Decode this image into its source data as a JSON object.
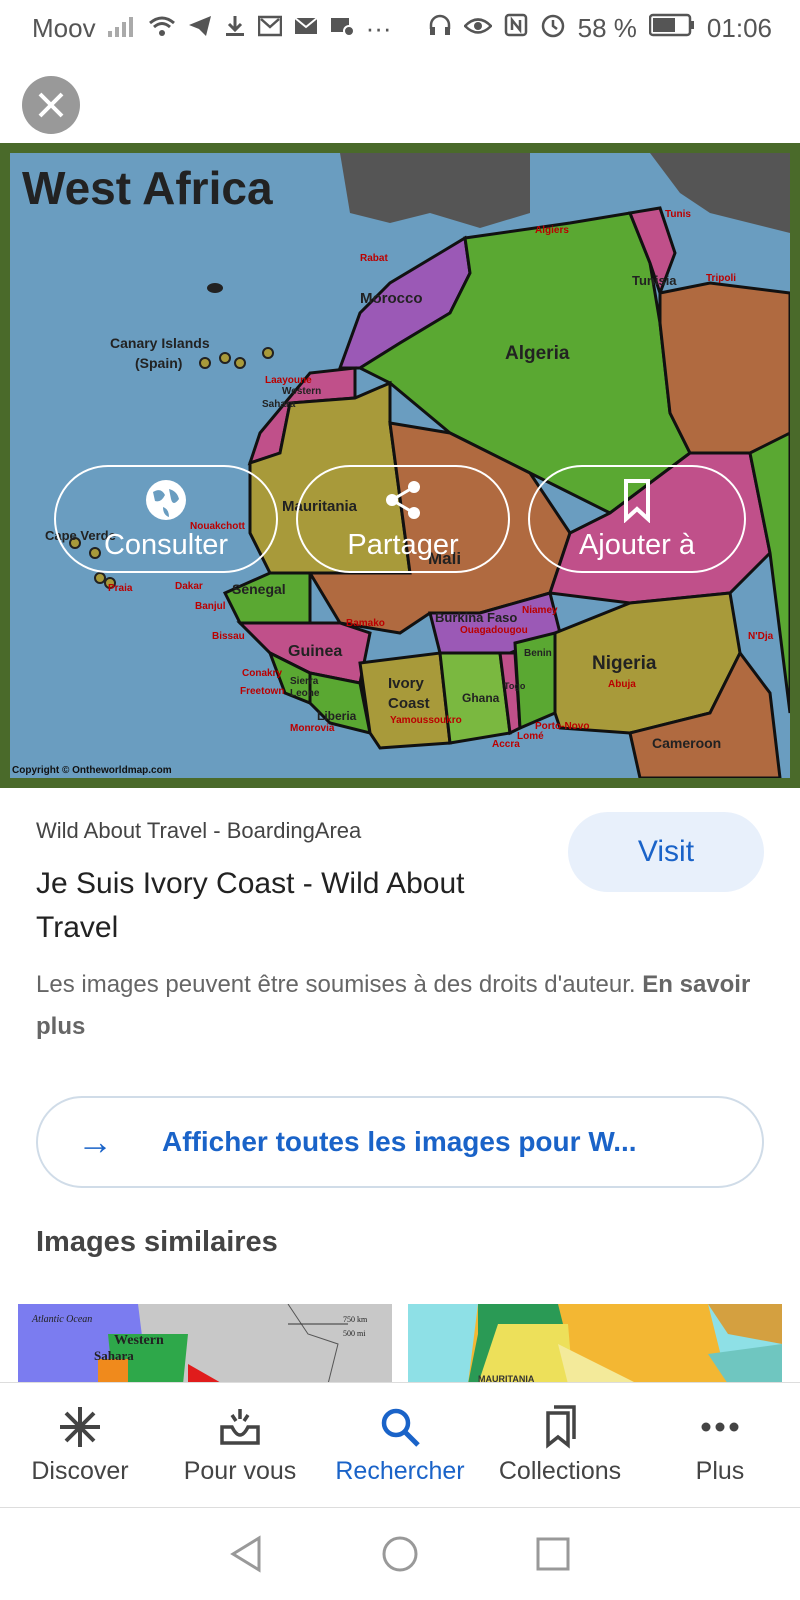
{
  "status_bar": {
    "carrier": "Moov",
    "battery": "58 %",
    "time": "01:06"
  },
  "map": {
    "title": "West Africa",
    "copyright": "Copyright © Ontheworldmap.com",
    "labels": {
      "morocco": "Morocco",
      "algeria": "Algeria",
      "tunisia": "Tunisia",
      "canary": "Canary Islands",
      "spain": "(Spain)",
      "western": "Western",
      "sahara": "Sahara",
      "mauritania": "Mauritania",
      "mali": "Mali",
      "senegal": "Senegal",
      "guinea": "Guinea",
      "sierra": "Sierra",
      "leone": "Leone",
      "liberia": "Liberia",
      "ivory": "Ivory",
      "coast": "Coast",
      "ghana": "Ghana",
      "togo": "Togo",
      "benin": "Benin",
      "burkina": "Burkina Faso",
      "nigeria": "Nigeria",
      "cameroon": "Cameroon",
      "cape_verde": "Cape Verde"
    },
    "cities": {
      "rabat": "Rabat",
      "algiers": "Algiers",
      "tunis": "Tunis",
      "tripoli": "Tripoli",
      "dakar": "Dakar",
      "bamako": "Bamako",
      "niamey": "Niamey",
      "ouagadougou": "Ouagadougou",
      "abuja": "Abuja",
      "conakry": "Conakry",
      "freetown": "Freetown",
      "monrovia": "Monrovia",
      "yamoussoukro": "Yamoussoukro",
      "accra": "Accra",
      "lome": "Lomé",
      "porto_novo": "Porto-Novo",
      "praia": "Praia",
      "banjul": "Banjul",
      "bissau": "Bissau",
      "nouakchott": "Nouakchott",
      "laayoune": "Laayoune",
      "ndjamena": "N'Dja"
    }
  },
  "actions": {
    "consult": "Consulter",
    "share": "Partager",
    "add": "Ajouter à"
  },
  "result": {
    "source": "Wild About Travel - BoardingArea",
    "title": "Je Suis Ivory Coast - Wild About Travel",
    "visit": "Visit",
    "copyright_text": "Les images peuvent être soumises à des droits d'auteur. ",
    "learn_more": "En savoir plus"
  },
  "show_all": "Afficher toutes les images pour W...",
  "similar_title": "Images similaires",
  "thumb1": {
    "ocean": "Atlantic Ocean",
    "western": "Western",
    "sahara": "Sahara",
    "scale1": "750 km",
    "scale2": "500 mi"
  },
  "thumb2": {
    "label": "MAURITANIA"
  },
  "nav": {
    "discover": "Discover",
    "for_you": "Pour vous",
    "search": "Rechercher",
    "collections": "Collections",
    "more": "Plus"
  }
}
